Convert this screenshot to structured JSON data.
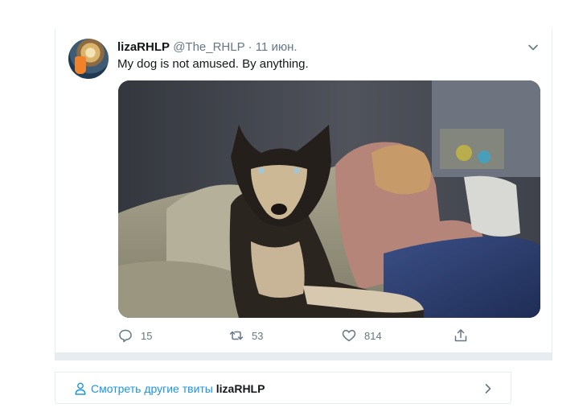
{
  "tweet": {
    "display_name": "lizaRHLP",
    "handle": "@The_RHLP",
    "separator": "·",
    "date": "11 июн.",
    "text": "My dog is not amused.  By anything.",
    "avatar_icon": "avatar",
    "menu_icon": "chevron-down-icon",
    "media_description_icon": "photo"
  },
  "actions": {
    "reply": {
      "icon": "reply-icon",
      "count": "15"
    },
    "retweet": {
      "icon": "retweet-icon",
      "count": "53"
    },
    "like": {
      "icon": "heart-icon",
      "count": "814"
    },
    "share": {
      "icon": "share-icon"
    }
  },
  "footer": {
    "link_text": "Смотреть другие твиты",
    "username": "lizaRHLP",
    "person_icon": "person-icon",
    "chevron_icon": "chevron-right-icon"
  },
  "colors": {
    "text_primary": "#14171a",
    "text_secondary": "#657786",
    "link": "#1b95e0",
    "border": "#e6ecf0"
  }
}
